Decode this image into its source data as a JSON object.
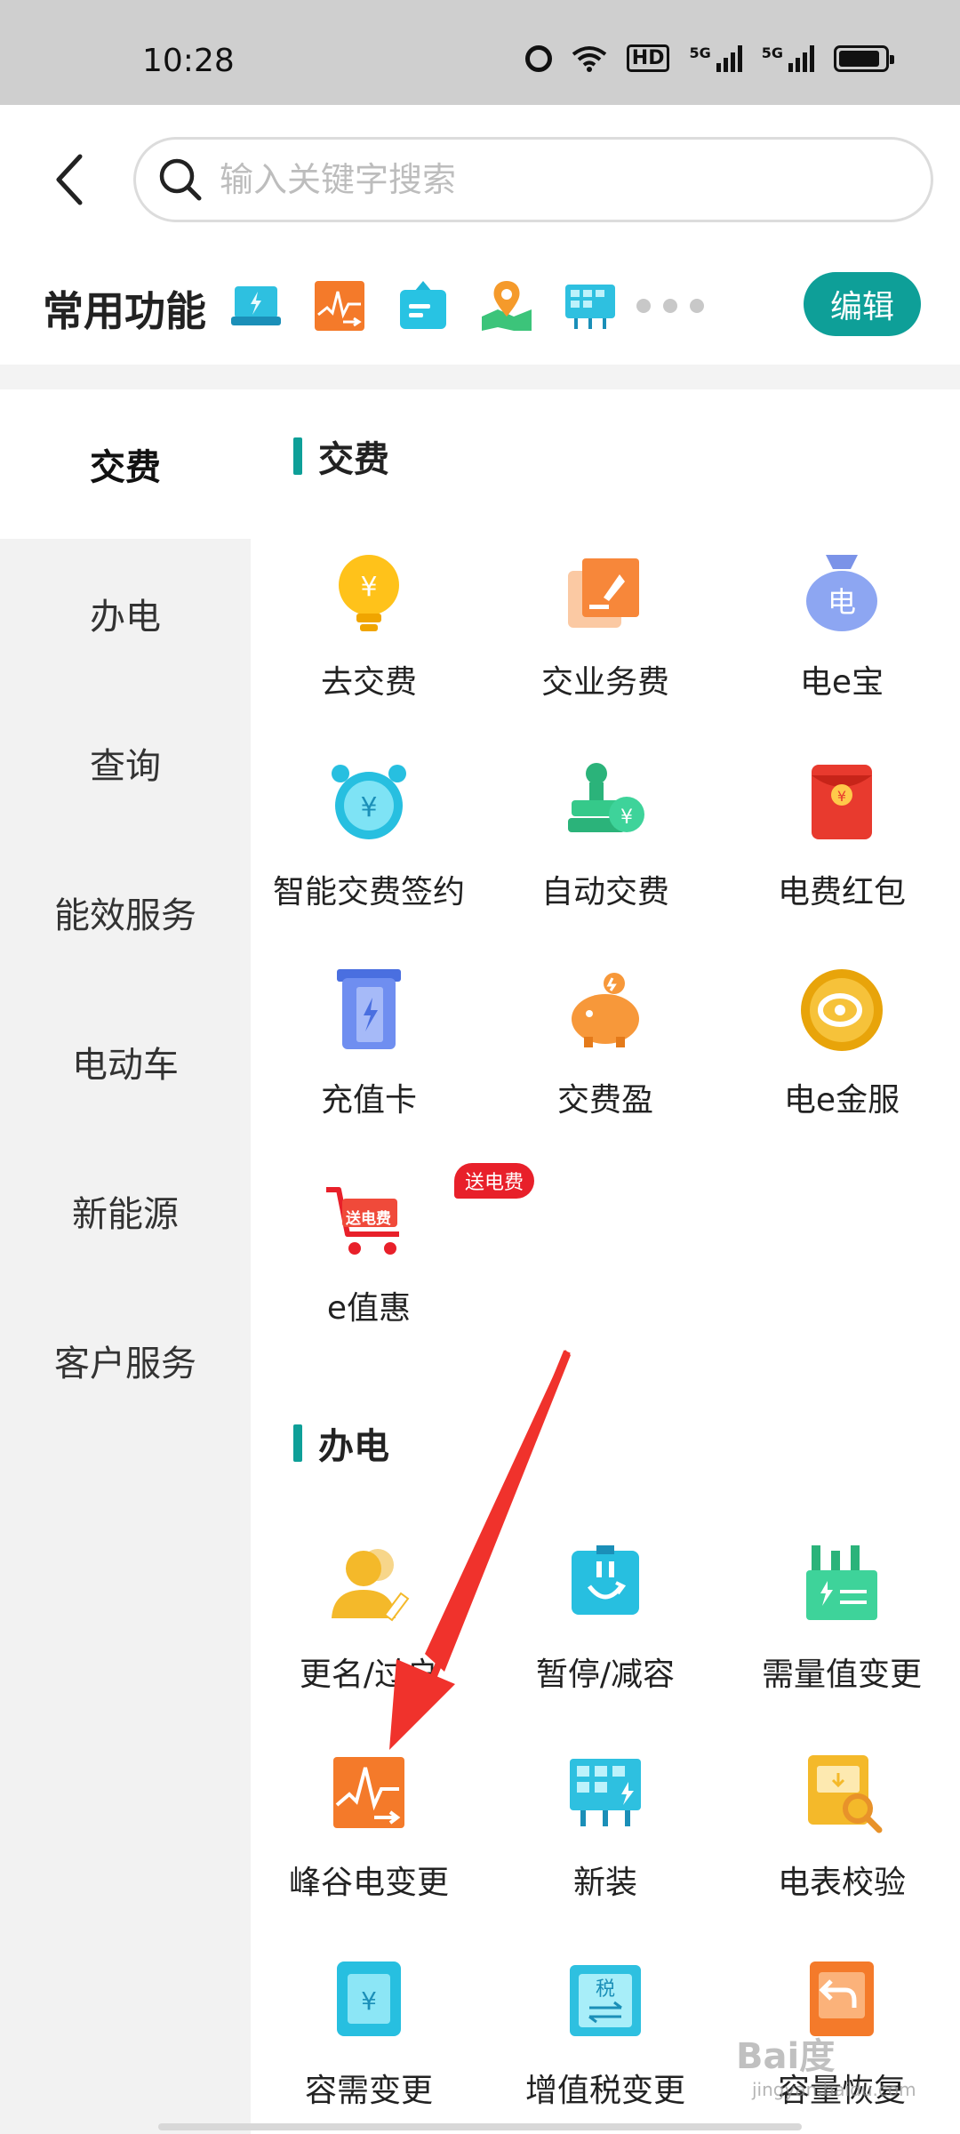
{
  "status": {
    "time": "10:28",
    "hd_label": "HD",
    "network_1": "5G",
    "network_2": "5G",
    "icons": [
      "alarm-icon",
      "wifi-icon",
      "hd-icon",
      "signal-icon",
      "signal-icon",
      "battery-icon"
    ]
  },
  "search": {
    "placeholder": "输入关键字搜索",
    "value": ""
  },
  "common": {
    "title": "常用功能",
    "edit_label": "编辑",
    "quick_icons": [
      "recharge-card-icon",
      "peak-valley-icon",
      "bill-icon",
      "map-icon",
      "new-install-icon"
    ]
  },
  "sidebar": {
    "items": [
      {
        "label": "交费",
        "active": true
      },
      {
        "label": "办电",
        "active": false
      },
      {
        "label": "查询",
        "active": false
      },
      {
        "label": "能效服务",
        "active": false
      },
      {
        "label": "电动车",
        "active": false
      },
      {
        "label": "新能源",
        "active": false
      },
      {
        "label": "客户服务",
        "active": false
      }
    ]
  },
  "sections": [
    {
      "title": "交费",
      "items": [
        {
          "label": "去交费",
          "icon": "bulb-coin-icon"
        },
        {
          "label": "交业务费",
          "icon": "pay-document-icon"
        },
        {
          "label": "电e宝",
          "icon": "money-bag-icon"
        },
        {
          "label": "智能交费签约",
          "icon": "alarm-clock-coin-icon"
        },
        {
          "label": "自动交费",
          "icon": "stamp-coin-icon"
        },
        {
          "label": "电费红包",
          "icon": "red-envelope-icon"
        },
        {
          "label": "充值卡",
          "icon": "recharge-card-icon"
        },
        {
          "label": "交费盈",
          "icon": "piggy-bank-icon"
        },
        {
          "label": "电e金服",
          "icon": "finance-coin-icon"
        },
        {
          "label": "e值惠",
          "icon": "shopping-cart-icon",
          "badge": "送电费",
          "cart_text": "送电费"
        }
      ]
    },
    {
      "title": "办电",
      "items": [
        {
          "label": "更名/过户",
          "icon": "user-rename-icon"
        },
        {
          "label": "暂停/减容",
          "icon": "pause-reduce-icon"
        },
        {
          "label": "需量值变更",
          "icon": "factory-icon"
        },
        {
          "label": "峰谷电变更",
          "icon": "peak-valley-icon"
        },
        {
          "label": "新装",
          "icon": "new-install-icon"
        },
        {
          "label": "电表校验",
          "icon": "meter-check-icon"
        },
        {
          "label": "容需变更",
          "icon": "capacity-change-icon"
        },
        {
          "label": "增值税变更",
          "icon": "vat-change-icon"
        },
        {
          "label": "容量恢复",
          "icon": "capacity-restore-icon",
          "tax_text": "税"
        }
      ]
    }
  ],
  "watermark": {
    "main": "Bai度",
    "sub": "jingyan.baidu.com"
  },
  "colors": {
    "accent": "#0e9f98",
    "sidebar_bg": "#f2f2f2",
    "arrow": "#f0322c",
    "badge": "#e8202a"
  }
}
